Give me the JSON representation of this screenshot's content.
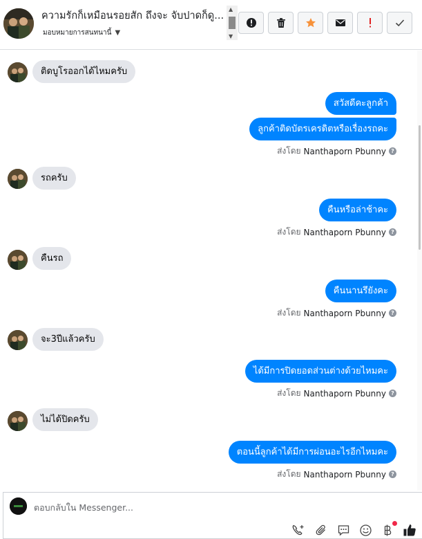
{
  "header": {
    "title": "ความรักก็เหมือนรอยสัก ถึงจะ จับปาดก็ดู...",
    "assign_label": "มอบหมายการสนทนานี้",
    "toolbar": [
      {
        "name": "spam-button",
        "icon": "exclamation-circle-icon"
      },
      {
        "name": "delete-button",
        "icon": "trash-icon"
      },
      {
        "name": "star-button",
        "icon": "star-icon"
      },
      {
        "name": "mark-unread-button",
        "icon": "envelope-icon"
      },
      {
        "name": "follow-up-button",
        "icon": "exclamation-icon"
      },
      {
        "name": "mark-done-button",
        "icon": "check-icon"
      }
    ]
  },
  "messages": [
    {
      "side": "in",
      "text": "ติดบูโรออกได้ไหมครับ"
    },
    {
      "side": "out",
      "text": "สวัสดีคะลูกค้า"
    },
    {
      "side": "out",
      "text": "ลูกค้าติดบัตรเครดิตหรือเรื่องรถคะ"
    },
    {
      "side": "in",
      "text": "รถครับ"
    },
    {
      "side": "out",
      "text": "คืนหรือล่าช้าคะ"
    },
    {
      "side": "in",
      "text": "คืนรถ"
    },
    {
      "side": "out",
      "text": "คืนนานรึยังคะ"
    },
    {
      "side": "in",
      "text": "จะ3ปีแล้วครับ"
    },
    {
      "side": "out",
      "text": "ได้มีการปิดยอดส่วนต่างด้วยไหมคะ"
    },
    {
      "side": "in",
      "text": "ไม่ได้ปิดครับ"
    },
    {
      "side": "out",
      "text": "ตอนนี้ลูกค้าได้มีการผ่อนอะไรอีกไหมคะ"
    }
  ],
  "sent_by": {
    "prefix": "ส่งโดย",
    "name": "Nanthaporn Pbunny",
    "help": "?"
  },
  "composer": {
    "placeholder": "ตอบกลับใน Messenger...",
    "icons": [
      "phone-plus-icon",
      "paperclip-icon",
      "saved-reply-icon",
      "emoji-icon",
      "baht-icon",
      "thumbs-up-icon"
    ]
  },
  "colors": {
    "outgoing": "#0084ff",
    "incoming": "#e4e6eb",
    "star": "#f7923a",
    "alert": "#e02020"
  }
}
